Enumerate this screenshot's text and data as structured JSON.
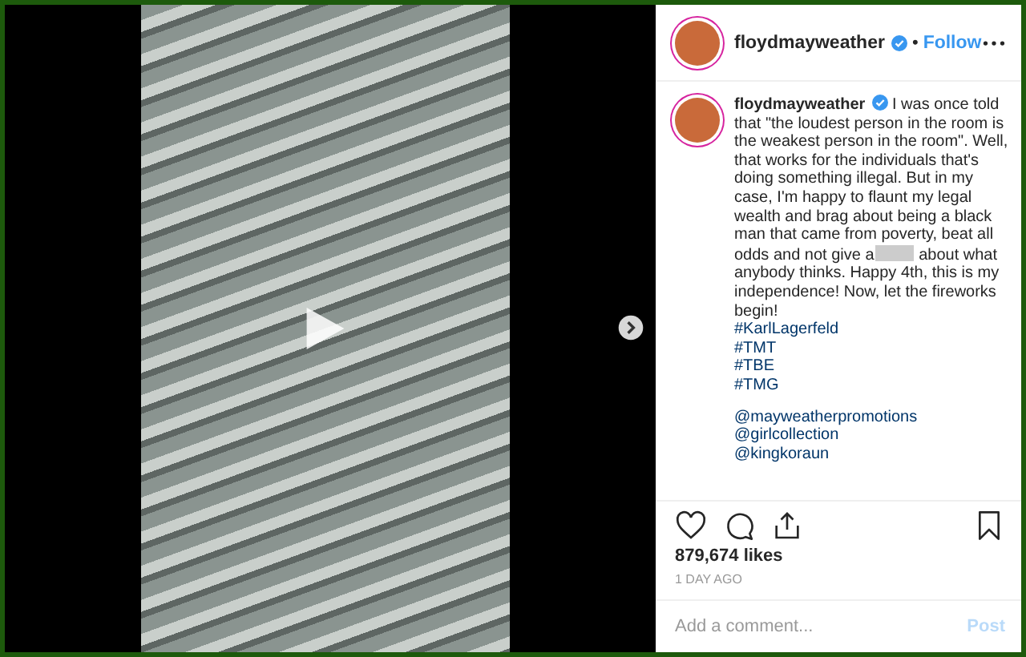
{
  "post": {
    "header": {
      "username": "floydmayweather",
      "verified": true,
      "separator": "•",
      "follow": "Follow"
    },
    "caption": {
      "username": "floydmayweather",
      "verified": true,
      "text_before": "I was once told that \"the loudest person in the room is the weakest person in the room\". Well, that works for the individuals that's doing something illegal. But in my case, I'm happy to flaunt my legal wealth and brag about being a black man that came from poverty, beat all odds and not give a",
      "censored": true,
      "text_after": "about what anybody thinks. Happy 4th, this is my independence! Now, let the fireworks begin!",
      "hashtags": [
        "#KarlLagerfeld",
        "#TMT",
        "#TBE",
        "#TMG"
      ],
      "mentions": [
        "@mayweatherpromotions",
        "@girlcollection",
        "@kingkoraun"
      ]
    },
    "likes": "879,674 likes",
    "time": "1 DAY AGO",
    "comment": {
      "placeholder": "Add a comment...",
      "post_button": "Post",
      "post_enabled": false
    }
  }
}
